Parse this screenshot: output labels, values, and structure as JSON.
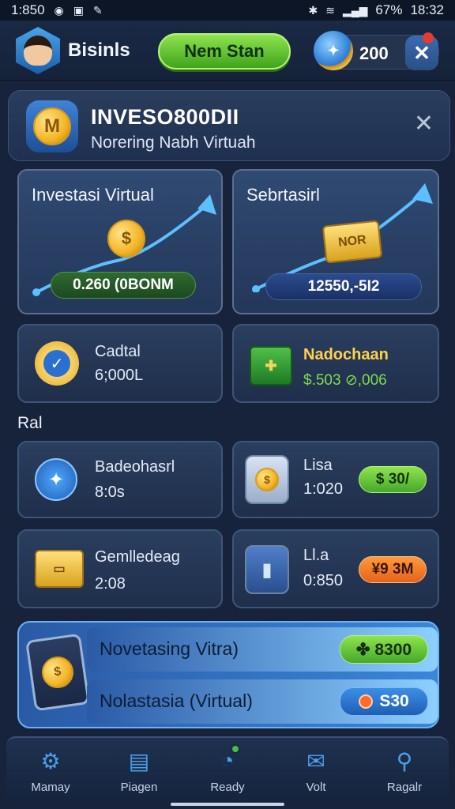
{
  "status_bar": {
    "time_left": "1:850",
    "battery": "67%",
    "time_right": "18:32"
  },
  "header": {
    "brand": "Bisinls",
    "primary_button": "Nem Stan",
    "currency_value": "200"
  },
  "banner": {
    "title": "INVESO800DII",
    "subtitle": "Norering Nabh Virtuah"
  },
  "feature_cards": [
    {
      "title": "Investasi Virtual",
      "pill": "0.260 (0BONM"
    },
    {
      "title": "Sebrtasirl",
      "box_label": "NOR",
      "pill": "12550,-5I2"
    }
  ],
  "stat_cards": [
    {
      "title": "Cadtal",
      "value": "6;000L"
    },
    {
      "title": "Nadochaan",
      "value": "$.503 ⊘,006"
    }
  ],
  "section_label": "Ral",
  "items": [
    {
      "title": "Badeohasrl",
      "value": "8:0s"
    },
    {
      "title": "Lisa",
      "value": "1:020",
      "pill": "$ 30/"
    },
    {
      "title": "Gemlledeag",
      "value": "2:08"
    },
    {
      "title": "Ll.a",
      "value": "0:850",
      "pill": "¥9 3M"
    }
  ],
  "actions": [
    {
      "label": "Novetasing Vitra)",
      "button": "✤ 8300"
    },
    {
      "label": "Nolastasia (Virtual)",
      "button": "S30"
    }
  ],
  "bottom_nav": [
    {
      "label": "Mamay",
      "icon": "gear-icon"
    },
    {
      "label": "Piagen",
      "icon": "document-icon"
    },
    {
      "label": "Ready",
      "icon": "compass-icon"
    },
    {
      "label": "Volt",
      "icon": "mail-icon"
    },
    {
      "label": "Ragalr",
      "icon": "search-icon"
    }
  ]
}
